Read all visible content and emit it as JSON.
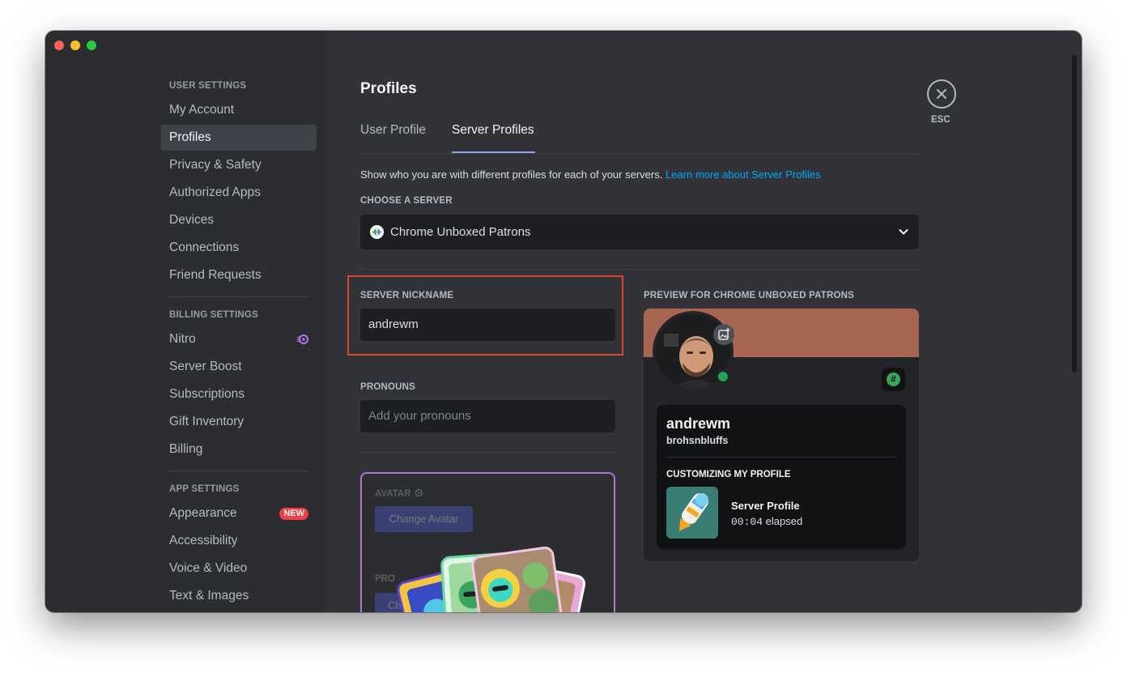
{
  "sidebar": {
    "user_settings_header": "USER SETTINGS",
    "user_items": [
      {
        "label": "My Account"
      },
      {
        "label": "Profiles",
        "active": true
      },
      {
        "label": "Privacy & Safety"
      },
      {
        "label": "Authorized Apps"
      },
      {
        "label": "Devices"
      },
      {
        "label": "Connections"
      },
      {
        "label": "Friend Requests"
      }
    ],
    "billing_settings_header": "BILLING SETTINGS",
    "billing_items": [
      {
        "label": "Nitro",
        "icon": "nitro-icon"
      },
      {
        "label": "Server Boost"
      },
      {
        "label": "Subscriptions"
      },
      {
        "label": "Gift Inventory"
      },
      {
        "label": "Billing"
      }
    ],
    "app_settings_header": "APP SETTINGS",
    "app_items": [
      {
        "label": "Appearance",
        "badge": "NEW"
      },
      {
        "label": "Accessibility"
      },
      {
        "label": "Voice & Video"
      },
      {
        "label": "Text & Images"
      }
    ]
  },
  "main": {
    "title": "Profiles",
    "tabs": [
      {
        "label": "User Profile"
      },
      {
        "label": "Server Profiles",
        "active": true
      }
    ],
    "description": "Show who you are with different profiles for each of your servers.",
    "learn_more": "Learn more about Server Profiles",
    "choose_server_label": "CHOOSE A SERVER",
    "selected_server": "Chrome Unboxed Patrons",
    "server_nickname_label": "SERVER NICKNAME",
    "server_nickname_value": "andrewm",
    "pronouns_label": "PRONOUNS",
    "pronouns_placeholder": "Add your pronouns",
    "nitro_card": {
      "avatar_label": "AVATAR",
      "change_avatar_button": "Change Avatar",
      "profile_label_partial": "PRO",
      "button_partial": "Ch"
    }
  },
  "preview": {
    "label": "PREVIEW FOR CHROME UNBOXED PATRONS",
    "display_name": "andrewm",
    "username": "brohsnbluffs",
    "customizing_header": "CUSTOMIZING MY PROFILE",
    "activity_title": "Server Profile",
    "elapsed_time": "00:04",
    "elapsed_label": "elapsed",
    "badge_symbol": "#"
  },
  "esc_label": "ESC",
  "colors": {
    "accent": "#5865f2",
    "link": "#00a8fc",
    "banner": "#a8654f",
    "highlight_border": "#e0432a",
    "online": "#23a559",
    "new_badge": "#f23f43"
  }
}
